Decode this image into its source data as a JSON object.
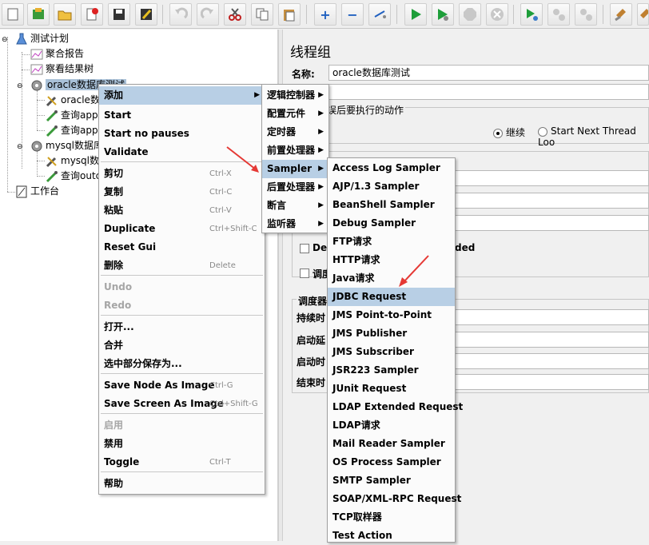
{
  "tree": {
    "root": "测试计划",
    "items": [
      "聚合报告",
      "察看结果树"
    ],
    "oracle_group": "oracle数据库测试",
    "oracle_children": [
      "oracle数",
      "查询app",
      "查询app"
    ],
    "mysql_group": "mysql数据库",
    "mysql_children": [
      "mysql数",
      "查询outc"
    ],
    "workbench": "工作台"
  },
  "panel": {
    "title": "线程组",
    "name_label": "名称:",
    "name_value": "oracle数据库测试",
    "error_action_label": "器错误后要执行的动作",
    "radio_continue": "继续",
    "radio_next_loop": "Start Next Thread Loo",
    "del_label": "Del",
    "del_tail": "ded",
    "tiao_label": "调度",
    "scheduler_title": "调度器",
    "duration_label": "持续时",
    "startup_delay_label": "启动延",
    "start_time_label": "启动时",
    "end_time_label": "结束时"
  },
  "context_menu": {
    "items": [
      {
        "label": "添加",
        "has_sub": true
      },
      {
        "label": "Start"
      },
      {
        "label": "Start no pauses"
      },
      {
        "label": "Validate"
      },
      {
        "label": "剪切",
        "acc": "Ctrl-X"
      },
      {
        "label": "复制",
        "acc": "Ctrl-C"
      },
      {
        "label": "粘贴",
        "acc": "Ctrl-V"
      },
      {
        "label": "Duplicate",
        "acc": "Ctrl+Shift-C"
      },
      {
        "label": "Reset Gui"
      },
      {
        "label": "删除",
        "acc": "Delete"
      },
      {
        "label": "Undo"
      },
      {
        "label": "Redo"
      },
      {
        "label": "打开..."
      },
      {
        "label": "合并"
      },
      {
        "label": "选中部分保存为..."
      },
      {
        "label": "Save Node As Image",
        "acc": "Ctrl-G"
      },
      {
        "label": "Save Screen As Image",
        "acc": "Ctrl+Shift-G"
      },
      {
        "label": "启用"
      },
      {
        "label": "禁用"
      },
      {
        "label": "Toggle",
        "acc": "Ctrl-T"
      },
      {
        "label": "帮助"
      }
    ]
  },
  "add_submenu": {
    "items": [
      "逻辑控制器",
      "配置元件",
      "定时器",
      "前置处理器",
      "Sampler",
      "后置处理器",
      "断言",
      "监听器"
    ]
  },
  "sampler_submenu": {
    "items": [
      "Access Log Sampler",
      "AJP/1.3 Sampler",
      "BeanShell Sampler",
      "Debug Sampler",
      "FTP请求",
      "HTTP请求",
      "Java请求",
      "JDBC Request",
      "JMS Point-to-Point",
      "JMS Publisher",
      "JMS Subscriber",
      "JSR223 Sampler",
      "JUnit Request",
      "LDAP Extended Request",
      "LDAP请求",
      "Mail Reader Sampler",
      "OS Process Sampler",
      "SMTP Sampler",
      "SOAP/XML-RPC Request",
      "TCP取样器",
      "Test Action"
    ]
  },
  "colors": {
    "highlight": "#b8cfe5",
    "selection": "#a9c1d8",
    "annotation_arrow": "#e53935"
  },
  "toolbar_icons": [
    "new-icon",
    "templates-icon",
    "open-icon",
    "close-icon",
    "save-icon",
    "save-as-icon",
    "undo-icon",
    "redo-icon",
    "cut-icon",
    "copy-icon",
    "paste-icon",
    "expand-icon",
    "collapse-icon",
    "toggle-icon",
    "start-icon",
    "start-no-pause-icon",
    "stop-icon",
    "shutdown-icon",
    "remote-start-icon",
    "remote-stop-icon",
    "remote-shutdown-icon",
    "clear-icon",
    "clear-all-icon"
  ]
}
